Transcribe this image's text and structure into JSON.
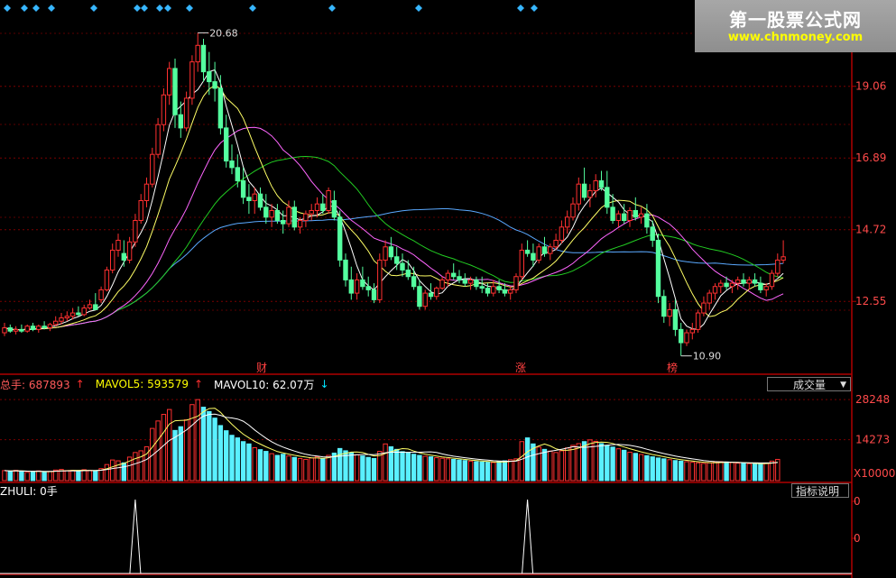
{
  "logo": {
    "title": "第一股票公式网",
    "url": "www.chnmoney.com"
  },
  "chart_data": [
    {
      "type": "candlestick",
      "panel": "price",
      "y_ticks": [
        "19.06",
        "16.89",
        "14.72",
        "12.55"
      ],
      "ylim": [
        10.4,
        21.4
      ],
      "high_marker": "20.68",
      "low_marker": "10.90",
      "event_markers": [
        "财",
        "涨",
        "榜"
      ],
      "colors": {
        "up": "#ff3030",
        "down": "#54ff9f",
        "ma5": "#ffffff",
        "ma10": "#ffff66",
        "ma20": "#ff66ff",
        "ma30": "#22cc22",
        "ma60": "#5aa9ff"
      },
      "candles_ohlc": [
        [
          11.6,
          11.9,
          11.5,
          11.75
        ],
        [
          11.75,
          11.85,
          11.6,
          11.65
        ],
        [
          11.65,
          11.8,
          11.55,
          11.7
        ],
        [
          11.7,
          11.85,
          11.6,
          11.65
        ],
        [
          11.65,
          11.85,
          11.6,
          11.8
        ],
        [
          11.8,
          11.9,
          11.65,
          11.7
        ],
        [
          11.7,
          11.85,
          11.6,
          11.8
        ],
        [
          11.8,
          11.95,
          11.7,
          11.75
        ],
        [
          11.75,
          11.9,
          11.65,
          11.85
        ],
        [
          11.85,
          12.1,
          11.8,
          11.95
        ],
        [
          11.95,
          12.2,
          11.85,
          12.05
        ],
        [
          12.05,
          12.25,
          11.95,
          12.1
        ],
        [
          12.1,
          12.35,
          12.0,
          12.2
        ],
        [
          12.2,
          12.4,
          12.1,
          12.15
        ],
        [
          12.15,
          12.45,
          12.1,
          12.35
        ],
        [
          12.35,
          12.6,
          12.3,
          12.45
        ],
        [
          12.45,
          12.8,
          12.4,
          12.3
        ],
        [
          12.6,
          13.0,
          12.5,
          12.9
        ],
        [
          12.9,
          13.6,
          12.85,
          13.5
        ],
        [
          13.5,
          14.3,
          13.4,
          14.1
        ],
        [
          14.1,
          14.6,
          13.9,
          14.4
        ],
        [
          14.0,
          14.4,
          13.6,
          13.8
        ],
        [
          13.8,
          14.5,
          13.7,
          14.35
        ],
        [
          14.35,
          15.2,
          14.2,
          15.0
        ],
        [
          15.0,
          15.8,
          14.9,
          15.6
        ],
        [
          15.6,
          16.3,
          15.4,
          16.1
        ],
        [
          16.1,
          17.2,
          16.0,
          17.0
        ],
        [
          17.0,
          18.1,
          16.9,
          17.9
        ],
        [
          17.9,
          19.0,
          17.7,
          18.8
        ],
        [
          18.8,
          19.8,
          18.5,
          19.6
        ],
        [
          19.6,
          19.9,
          17.8,
          18.2
        ],
        [
          18.2,
          18.6,
          17.5,
          17.8
        ],
        [
          17.8,
          18.9,
          17.7,
          18.7
        ],
        [
          18.7,
          20.0,
          18.5,
          19.8
        ],
        [
          19.8,
          20.68,
          19.5,
          20.3
        ],
        [
          20.3,
          20.5,
          19.2,
          19.5
        ],
        [
          19.5,
          20.1,
          18.8,
          19.2
        ],
        [
          19.2,
          19.8,
          18.6,
          19.0
        ],
        [
          19.0,
          19.4,
          17.6,
          17.8
        ],
        [
          17.8,
          18.2,
          16.6,
          16.8
        ],
        [
          16.8,
          17.3,
          16.4,
          16.6
        ],
        [
          16.6,
          17.0,
          16.0,
          16.2
        ],
        [
          16.2,
          16.6,
          15.5,
          15.7
        ],
        [
          15.7,
          16.1,
          15.2,
          15.6
        ],
        [
          15.6,
          16.0,
          15.2,
          15.8
        ],
        [
          15.8,
          16.0,
          15.3,
          15.4
        ],
        [
          15.4,
          15.8,
          14.9,
          15.1
        ],
        [
          15.1,
          15.5,
          14.8,
          15.3
        ],
        [
          15.3,
          15.5,
          14.9,
          15.0
        ],
        [
          15.0,
          15.3,
          14.6,
          14.9
        ],
        [
          14.9,
          15.6,
          14.8,
          15.4
        ],
        [
          15.4,
          15.6,
          14.7,
          14.8
        ],
        [
          14.8,
          15.1,
          14.6,
          15.0
        ],
        [
          15.0,
          15.3,
          14.8,
          15.2
        ],
        [
          15.2,
          15.5,
          15.0,
          15.3
        ],
        [
          15.3,
          15.7,
          15.1,
          15.5
        ],
        [
          15.5,
          15.8,
          15.2,
          15.3
        ],
        [
          15.3,
          16.0,
          15.2,
          15.9
        ],
        [
          15.6,
          15.9,
          15.0,
          15.1
        ],
        [
          15.1,
          15.3,
          13.6,
          13.8
        ],
        [
          13.8,
          14.0,
          13.0,
          13.2
        ],
        [
          13.2,
          13.6,
          12.6,
          12.8
        ],
        [
          12.8,
          13.4,
          12.6,
          13.2
        ],
        [
          13.2,
          13.6,
          12.9,
          13.0
        ],
        [
          13.0,
          13.3,
          12.7,
          12.9
        ],
        [
          12.9,
          13.1,
          12.5,
          12.6
        ],
        [
          12.6,
          14.0,
          12.5,
          13.8
        ],
        [
          13.8,
          14.4,
          13.6,
          14.2
        ],
        [
          14.2,
          14.5,
          13.8,
          13.9
        ],
        [
          13.9,
          14.2,
          13.5,
          13.7
        ],
        [
          13.7,
          14.0,
          13.3,
          13.5
        ],
        [
          13.5,
          13.8,
          13.2,
          13.3
        ],
        [
          13.3,
          13.6,
          12.9,
          13.0
        ],
        [
          13.0,
          13.2,
          12.3,
          12.4
        ],
        [
          12.4,
          12.9,
          12.3,
          12.8
        ],
        [
          12.8,
          13.1,
          12.6,
          12.7
        ],
        [
          12.7,
          13.0,
          12.6,
          12.95
        ],
        [
          12.95,
          13.3,
          12.9,
          13.2
        ],
        [
          13.2,
          13.5,
          13.0,
          13.4
        ],
        [
          13.4,
          13.7,
          13.2,
          13.3
        ],
        [
          13.3,
          13.5,
          13.1,
          13.2
        ],
        [
          13.2,
          13.4,
          13.0,
          13.1
        ],
        [
          13.1,
          13.3,
          12.9,
          13.2
        ],
        [
          13.2,
          13.3,
          12.9,
          13.0
        ],
        [
          13.0,
          13.3,
          12.8,
          12.95
        ],
        [
          12.95,
          13.1,
          12.7,
          12.8
        ],
        [
          12.8,
          13.2,
          12.7,
          13.0
        ],
        [
          13.0,
          13.2,
          12.8,
          12.9
        ],
        [
          12.9,
          13.1,
          12.7,
          12.8
        ],
        [
          12.8,
          13.0,
          12.6,
          12.9
        ],
        [
          12.9,
          13.4,
          12.8,
          13.3
        ],
        [
          13.3,
          14.3,
          13.2,
          14.1
        ],
        [
          14.1,
          14.4,
          13.9,
          14.0
        ],
        [
          14.0,
          14.3,
          13.6,
          13.8
        ],
        [
          13.8,
          14.3,
          13.7,
          14.2
        ],
        [
          14.2,
          14.5,
          13.9,
          14.0
        ],
        [
          14.0,
          14.3,
          13.8,
          14.2
        ],
        [
          14.2,
          14.6,
          14.1,
          14.4
        ],
        [
          14.4,
          15.0,
          14.3,
          14.8
        ],
        [
          14.8,
          15.3,
          14.6,
          15.1
        ],
        [
          15.1,
          15.7,
          15.0,
          15.5
        ],
        [
          15.5,
          16.3,
          15.3,
          16.1
        ],
        [
          16.1,
          16.6,
          15.6,
          15.7
        ],
        [
          15.7,
          16.1,
          15.4,
          15.9
        ],
        [
          15.9,
          16.4,
          15.7,
          16.2
        ],
        [
          16.2,
          16.5,
          15.9,
          16.0
        ],
        [
          16.0,
          16.5,
          15.2,
          15.4
        ],
        [
          15.4,
          15.8,
          14.9,
          15.0
        ],
        [
          15.0,
          15.3,
          14.8,
          15.2
        ],
        [
          15.2,
          15.5,
          14.9,
          15.0
        ],
        [
          15.0,
          15.4,
          14.8,
          15.3
        ],
        [
          15.3,
          15.7,
          15.0,
          15.1
        ],
        [
          15.1,
          15.4,
          14.9,
          15.2
        ],
        [
          15.2,
          15.5,
          14.6,
          14.8
        ],
        [
          14.8,
          15.0,
          14.2,
          14.4
        ],
        [
          14.4,
          14.6,
          12.5,
          12.7
        ],
        [
          12.7,
          12.9,
          11.9,
          12.1
        ],
        [
          12.1,
          12.5,
          11.8,
          12.3
        ],
        [
          12.3,
          12.6,
          11.5,
          11.7
        ],
        [
          11.7,
          11.9,
          10.9,
          11.3
        ],
        [
          11.3,
          11.7,
          11.2,
          11.6
        ],
        [
          11.6,
          11.9,
          11.4,
          11.7
        ],
        [
          11.7,
          12.3,
          11.6,
          12.2
        ],
        [
          12.2,
          12.7,
          12.1,
          12.5
        ],
        [
          12.5,
          12.9,
          12.3,
          12.8
        ],
        [
          12.8,
          13.1,
          12.6,
          13.0
        ],
        [
          13.0,
          13.2,
          12.8,
          13.1
        ],
        [
          13.1,
          13.3,
          12.9,
          13.0
        ],
        [
          13.0,
          13.2,
          12.8,
          13.1
        ],
        [
          13.1,
          13.3,
          12.9,
          13.2
        ],
        [
          13.2,
          13.4,
          13.0,
          13.1
        ],
        [
          13.1,
          13.3,
          12.9,
          13.2
        ],
        [
          13.2,
          13.4,
          13.0,
          13.1
        ],
        [
          13.1,
          13.3,
          12.8,
          12.9
        ],
        [
          12.9,
          13.1,
          12.7,
          13.0
        ],
        [
          13.0,
          13.5,
          12.9,
          13.4
        ],
        [
          13.4,
          14.0,
          13.3,
          13.8
        ],
        [
          13.8,
          14.4,
          13.7,
          13.9
        ]
      ]
    },
    {
      "type": "bar",
      "panel": "volume",
      "label": "总手: 687893",
      "mavol5_label": "MAVOL5: 593579",
      "mavol10_label": "MAVOL10: 62.07万",
      "y_ticks": [
        "28248",
        "14273"
      ],
      "unit": "X10000",
      "ylim": [
        0,
        30500
      ],
      "values": [
        3500,
        3200,
        3600,
        3300,
        2900,
        3100,
        3400,
        3000,
        3200,
        3700,
        3900,
        3500,
        3600,
        3300,
        3800,
        3600,
        3400,
        4200,
        5600,
        7200,
        6900,
        6200,
        8200,
        9800,
        10400,
        11800,
        18200,
        20800,
        23100,
        24800,
        17500,
        18800,
        21200,
        26500,
        28248,
        25600,
        24100,
        21800,
        19200,
        17400,
        15800,
        14900,
        13600,
        12800,
        11500,
        10800,
        10200,
        9400,
        8800,
        9200,
        8600,
        8100,
        7700,
        7400,
        7900,
        8300,
        7600,
        8800,
        9600,
        11200,
        10400,
        9700,
        9000,
        8600,
        8100,
        7700,
        10200,
        12800,
        11800,
        10900,
        10100,
        9600,
        9200,
        8800,
        8500,
        8300,
        8000,
        7800,
        7600,
        7400,
        7200,
        7000,
        6800,
        6600,
        6500,
        6400,
        6300,
        6600,
        6900,
        7300,
        7600,
        13600,
        14900,
        12800,
        11700,
        10900,
        10300,
        9800,
        10400,
        11400,
        12300,
        12900,
        13600,
        14200,
        13700,
        12900,
        12300,
        11700,
        11100,
        10600,
        9900,
        9500,
        9100,
        8700,
        8300,
        7900,
        7600,
        7300,
        7000,
        6800,
        6600,
        6400,
        6200,
        6000,
        6200,
        6400,
        6600,
        6500,
        6300,
        6100,
        6000,
        5900,
        5800,
        5900,
        6100,
        6800,
        7400
      ]
    },
    {
      "type": "line",
      "panel": "indicator",
      "label": "ZHULI: 0手",
      "y_ticks": [
        "0",
        "0"
      ],
      "spikes_at_index": [
        23,
        92
      ],
      "baseline": 0
    }
  ],
  "ui": {
    "vol_dropdown_label": "成交量",
    "indicator_button_label": "指标说明"
  },
  "top_diamonds_x": [
    8,
    27,
    40,
    57,
    104,
    152,
    160,
    177,
    186,
    210,
    280,
    368,
    464,
    577,
    592
  ]
}
